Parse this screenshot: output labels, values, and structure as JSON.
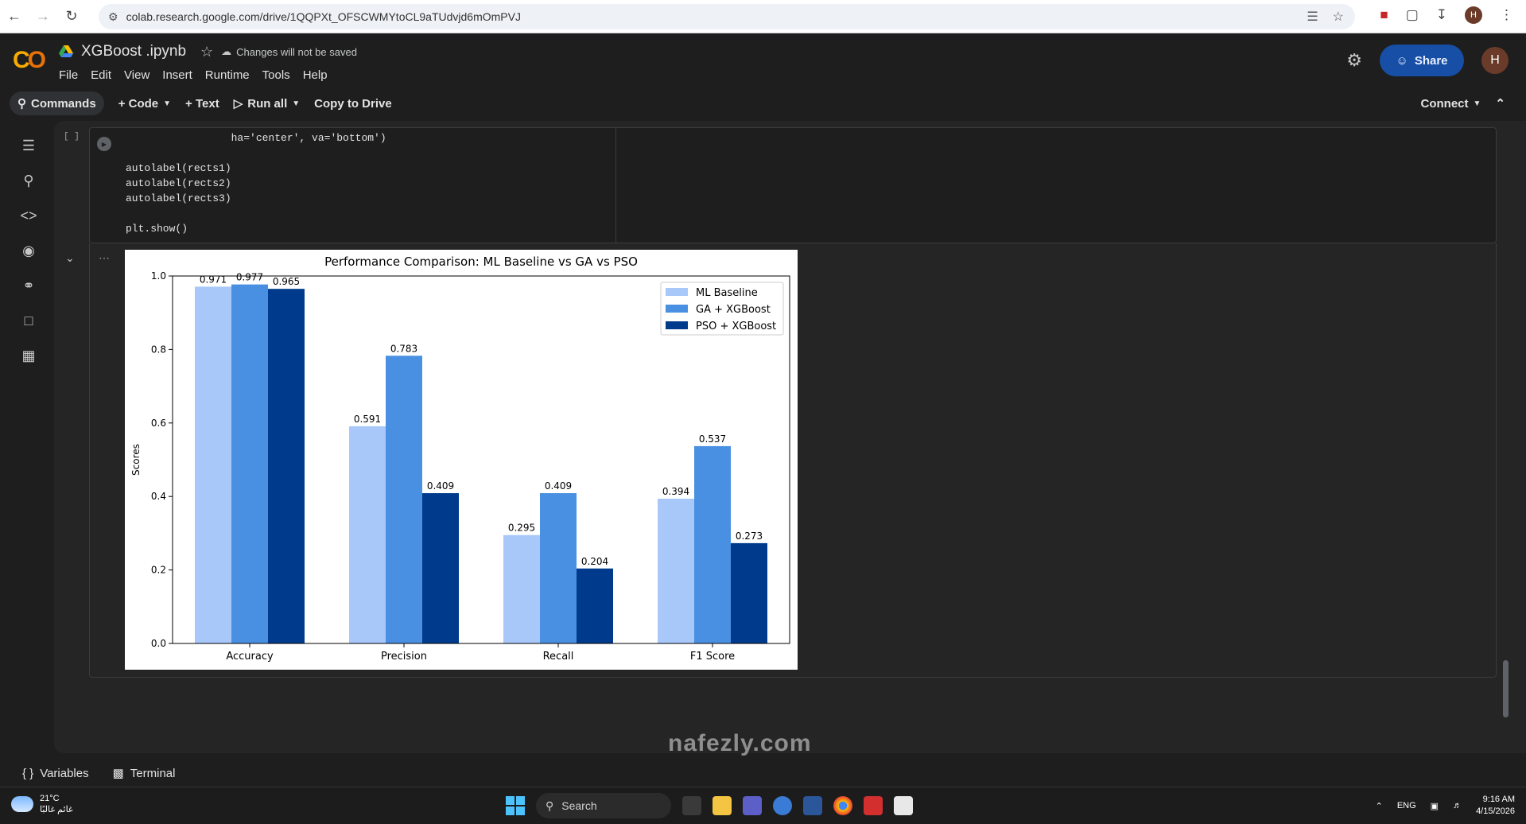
{
  "browser": {
    "url": "colab.research.google.com/drive/1QQPXt_OFSCWMYtoCL9aTUdvjd6mOmPVJ",
    "profile_initial": "H"
  },
  "header": {
    "file_title": "XGBoost .ipynb",
    "unsaved_text": "Changes will not be saved",
    "menu": [
      "File",
      "Edit",
      "View",
      "Insert",
      "Runtime",
      "Tools",
      "Help"
    ],
    "share_label": "Share",
    "profile_initial": "H"
  },
  "toolbar": {
    "commands_label": "Commands",
    "code_label": "+ Code",
    "text_label": "+ Text",
    "run_all_label": "Run all",
    "copy_label": "Copy to Drive",
    "connect_label": "Connect"
  },
  "cell": {
    "exec_count": "[ ]",
    "code_lines": [
      "                 ha='center', va='bottom')",
      "",
      "autolabel(rects1)",
      "autolabel(rects2)",
      "autolabel(rects3)",
      "",
      "plt.show()"
    ]
  },
  "chart_data": {
    "type": "bar",
    "title": "Performance Comparison: ML Baseline vs GA vs PSO",
    "xlabel": "",
    "ylabel": "Scores",
    "ylim": [
      0,
      1.0
    ],
    "yticks": [
      "0.0",
      "0.2",
      "0.4",
      "0.6",
      "0.8",
      "1.0"
    ],
    "categories": [
      "Accuracy",
      "Precision",
      "Recall",
      "F1 Score"
    ],
    "series": [
      {
        "name": "ML Baseline",
        "color": "#a8c8fa",
        "values": [
          0.971,
          0.591,
          0.295,
          0.394
        ]
      },
      {
        "name": "GA + XGBoost",
        "color": "#4a90e2",
        "values": [
          0.977,
          0.783,
          0.409,
          0.537
        ]
      },
      {
        "name": "PSO + XGBoost",
        "color": "#003a8c",
        "values": [
          0.965,
          0.409,
          0.204,
          0.273
        ]
      }
    ],
    "legend_position": "upper right"
  },
  "bottom_bar": {
    "variables_label": "Variables",
    "terminal_label": "Terminal"
  },
  "taskbar": {
    "temperature": "21°C",
    "weather_text": "غائم غالبًا",
    "search_label": "Search",
    "language": "ENG",
    "time": "9:16 AM",
    "date": "4/15/2026"
  },
  "watermark": {
    "text": "nafezly.com"
  }
}
